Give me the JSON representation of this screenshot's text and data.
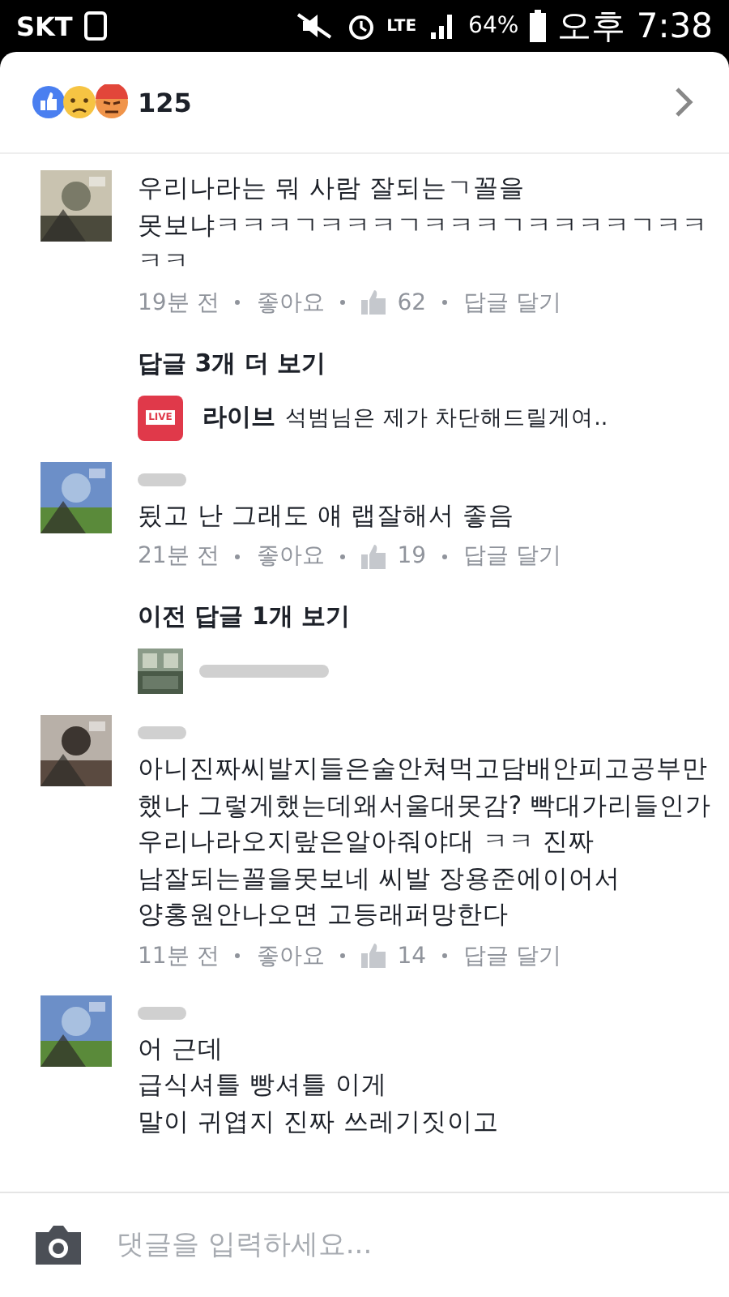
{
  "status_bar": {
    "carrier": "SKT",
    "network": "LTE",
    "battery": "64%",
    "time": "오후 7:38"
  },
  "reactions": {
    "count": "125"
  },
  "feed": [
    {
      "kind": "comment",
      "name_redacted": false,
      "lines": [
        "우리나라는 뭐 사람 잘되는ㄱ꼴을",
        "못보냐ㅋㅋㅋㄱㅋㅋㅋㄱㅋㅋㅋㄱㅋㅋㅋㅋㄱㅋㅋ",
        "ㅋㅋ"
      ],
      "meta": {
        "time": "19분 전",
        "like": "좋아요",
        "likes": "62",
        "reply": "답글 달기"
      }
    },
    {
      "kind": "more_replies",
      "label": "답글 3개 더 보기"
    },
    {
      "kind": "live_reply",
      "badge": "LIVE",
      "author": "라이브",
      "text": "석범님은 제가 차단해드릴게여.."
    },
    {
      "kind": "comment",
      "name_redacted": true,
      "lines": [
        "됬고 난 그래도 얘 랩잘해서 좋음"
      ],
      "meta": {
        "time": "21분 전",
        "like": "좋아요",
        "likes": "19",
        "reply": "답글 달기"
      }
    },
    {
      "kind": "more_replies",
      "label": "이전 답글 1개 보기"
    },
    {
      "kind": "reply_preview",
      "name_redacted": true
    },
    {
      "kind": "comment",
      "name_redacted": true,
      "lines": [
        "아니진짜씨발지들은술안쳐먹고담배안피고공부만",
        "했나 그렇게했는데왜서울대못감? 빡대가리들인가",
        "우리나라오지랖은알아줘야대 ㅋㅋ 진짜",
        "남잘되는꼴을못보네 씨발 장용준에이어서",
        "양홍원안나오면 고등래퍼망한다"
      ],
      "meta": {
        "time": "11분 전",
        "like": "좋아요",
        "likes": "14",
        "reply": "답글 달기"
      }
    },
    {
      "kind": "comment",
      "name_redacted": true,
      "lines": [
        "어 근데",
        "급식셔틀 빵셔틀 이게",
        "말이 귀엽지 진짜 쓰레기짓이고"
      ]
    }
  ],
  "composer": {
    "placeholder": "댓글을 입력하세요..."
  }
}
